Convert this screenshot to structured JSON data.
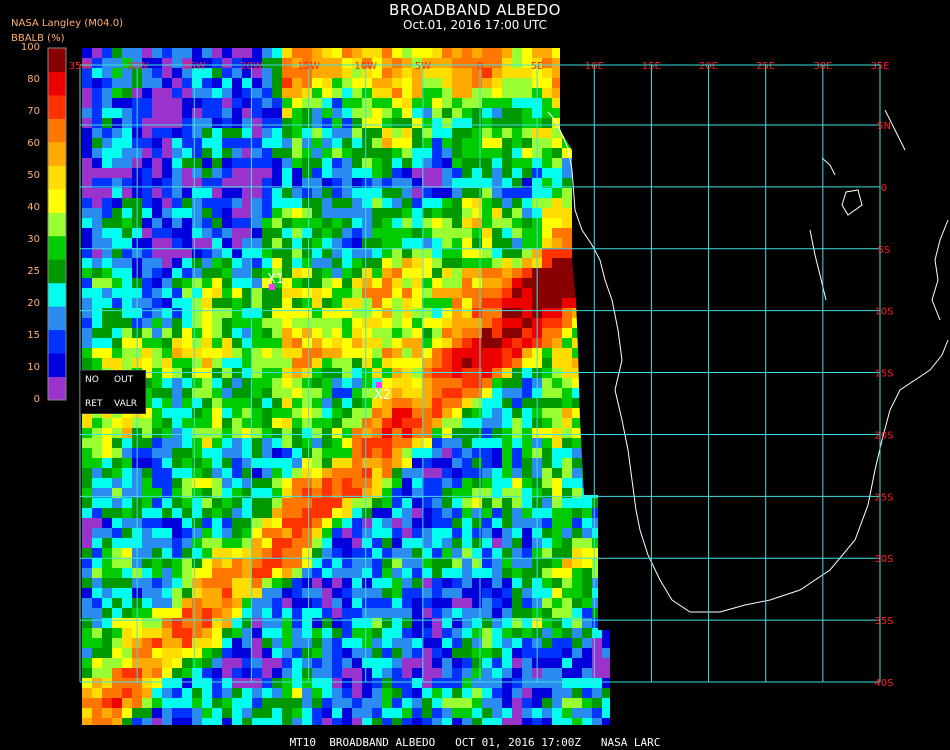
{
  "header": {
    "title": "BROADBAND ALBEDO",
    "subtitle": "Oct.01, 2016 17:00 UTC",
    "producer": "NASA Langley (M04.0)"
  },
  "footer": {
    "text": "MT10  BROADBAND ALBEDO   OCT 01, 2016 17:00Z   NASA LARC"
  },
  "colorbar": {
    "title": "BBALB (%)",
    "labels": [
      "100",
      "80",
      "70",
      "60",
      "50",
      "40",
      "30",
      "25",
      "20",
      "15",
      "10",
      "0"
    ],
    "bins": [
      {
        "lo": 0,
        "hi": 10,
        "color": "#9933cc"
      },
      {
        "lo": 10,
        "hi": 15,
        "color": "#0000dd"
      },
      {
        "lo": 15,
        "hi": 20,
        "color": "#0033ff"
      },
      {
        "lo": 20,
        "hi": 25,
        "color": "#2a8cf0"
      },
      {
        "lo": 25,
        "hi": 30,
        "color": "#00ffee"
      },
      {
        "lo": 30,
        "hi": 35,
        "color": "#009900"
      },
      {
        "lo": 35,
        "hi": 40,
        "color": "#00cc00"
      },
      {
        "lo": 40,
        "hi": 45,
        "color": "#99ff33"
      },
      {
        "lo": 45,
        "hi": 50,
        "color": "#ffff00"
      },
      {
        "lo": 50,
        "hi": 55,
        "color": "#ffdd00"
      },
      {
        "lo": 55,
        "hi": 60,
        "color": "#ffaa00"
      },
      {
        "lo": 60,
        "hi": 70,
        "color": "#ff7700"
      },
      {
        "lo": 70,
        "hi": 80,
        "color": "#ff3300"
      },
      {
        "lo": 80,
        "hi": 90,
        "color": "#ee0000"
      },
      {
        "lo": 90,
        "hi": 100,
        "color": "#880000"
      }
    ]
  },
  "qc_legend": {
    "no": "NO",
    "out": "OUT",
    "ret": "RET",
    "valr": "VALR"
  },
  "grid": {
    "lon_labels": [
      "35W",
      "30W",
      "25W",
      "20W",
      "15W",
      "10W",
      "5W",
      "0",
      "5E",
      "10E",
      "15E",
      "20E",
      "25E",
      "30E",
      "35E"
    ],
    "lat_labels": [
      "5N",
      "0",
      "5S",
      "10S",
      "15S",
      "20S",
      "25S",
      "30S",
      "35S",
      "40S"
    ],
    "grid_color": "#40e0e0",
    "label_color": "#ff2020",
    "coast_color": "#ffffff"
  },
  "markers": [
    {
      "label": "X1",
      "color": "#ff33ff"
    },
    {
      "label": "X2",
      "color": "#ff33ff"
    }
  ],
  "legend_colors": {
    "text": "#ffb070",
    "title": "#ffffff"
  }
}
